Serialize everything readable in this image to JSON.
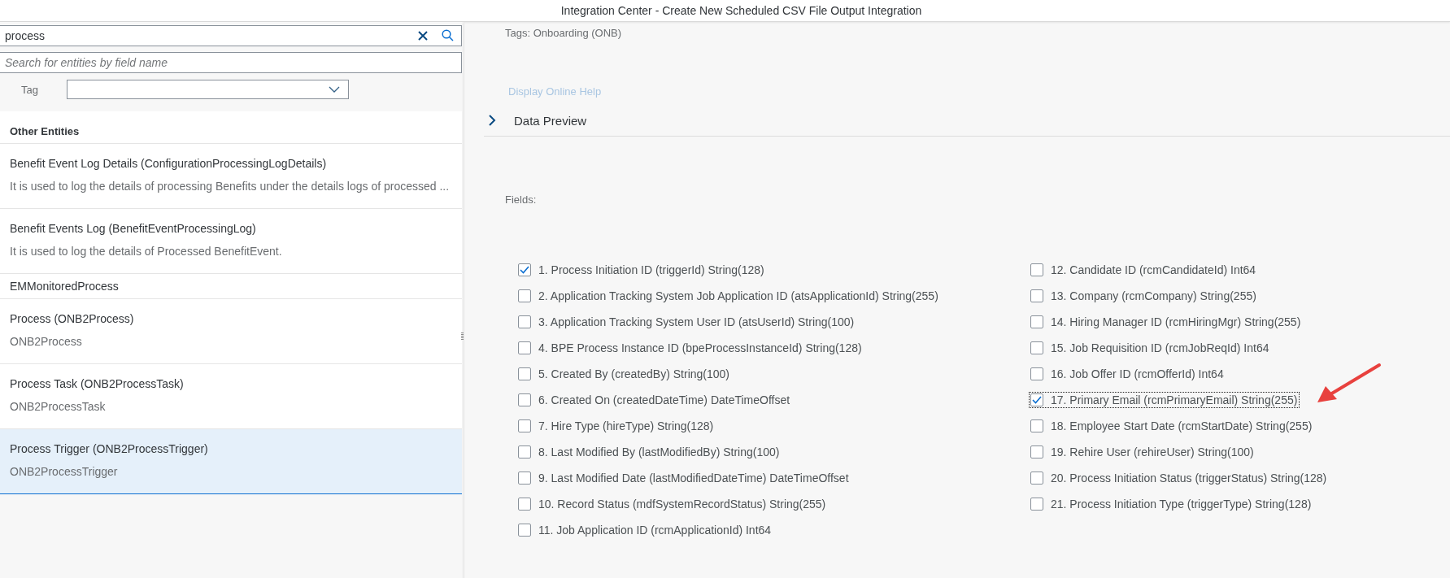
{
  "window": {
    "title": "Integration Center - Create New Scheduled CSV File Output Integration"
  },
  "sidebar": {
    "search": {
      "value": "process"
    },
    "field_search": {
      "placeholder": "Search for entities by field name"
    },
    "tag_label": "Tag",
    "section_title": "Other Entities",
    "items": [
      {
        "title": "Benefit Event Log Details (ConfigurationProcessingLogDetails)",
        "subtitle": "It is used to log the details of processing Benefits under the details logs of processed ...",
        "selected": false
      },
      {
        "title": "Benefit Events Log (BenefitEventProcessingLog)",
        "subtitle": "It is used to log the details of Processed BenefitEvent.",
        "selected": false
      },
      {
        "title": "EMMonitoredProcess",
        "selected": false
      },
      {
        "title": "Process (ONB2Process)",
        "subtitle": "ONB2Process",
        "selected": false
      },
      {
        "title": "Process Task (ONB2ProcessTask)",
        "subtitle": "ONB2ProcessTask",
        "selected": false
      },
      {
        "title": "Process Trigger (ONB2ProcessTrigger)",
        "subtitle": "ONB2ProcessTrigger",
        "selected": true
      }
    ]
  },
  "detail": {
    "tags": "Tags: Onboarding (ONB)",
    "help_link": "Display Online Help",
    "data_preview": {
      "label": "Data Preview",
      "expanded": false
    },
    "fields_label": "Fields:",
    "fields": [
      {
        "label": "1. Process Initiation ID (triggerId) String(128)",
        "checked": true,
        "focused": false
      },
      {
        "label": "2. Application Tracking System Job Application ID (atsApplicationId) String(255)",
        "checked": false,
        "focused": false
      },
      {
        "label": "3. Application Tracking System User ID (atsUserId) String(100)",
        "checked": false,
        "focused": false
      },
      {
        "label": "4. BPE Process Instance ID (bpeProcessInstanceId) String(128)",
        "checked": false,
        "focused": false
      },
      {
        "label": "5. Created By (createdBy) String(100)",
        "checked": false,
        "focused": false
      },
      {
        "label": "6. Created On (createdDateTime) DateTimeOffset",
        "checked": false,
        "focused": false
      },
      {
        "label": "7. Hire Type (hireType) String(128)",
        "checked": false,
        "focused": false
      },
      {
        "label": "8. Last Modified By (lastModifiedBy) String(100)",
        "checked": false,
        "focused": false
      },
      {
        "label": "9. Last Modified Date (lastModifiedDateTime) DateTimeOffset",
        "checked": false,
        "focused": false
      },
      {
        "label": "10. Record Status (mdfSystemRecordStatus) String(255)",
        "checked": false,
        "focused": false
      },
      {
        "label": "11. Job Application ID (rcmApplicationId) Int64",
        "checked": false,
        "focused": false
      },
      {
        "label": "12. Candidate ID (rcmCandidateId) Int64",
        "checked": false,
        "focused": false
      },
      {
        "label": "13. Company (rcmCompany) String(255)",
        "checked": false,
        "focused": false
      },
      {
        "label": "14. Hiring Manager ID (rcmHiringMgr) String(255)",
        "checked": false,
        "focused": false
      },
      {
        "label": "15. Job Requisition ID (rcmJobReqId) Int64",
        "checked": false,
        "focused": false
      },
      {
        "label": "16. Job Offer ID (rcmOfferId) Int64",
        "checked": false,
        "focused": false
      },
      {
        "label": "17. Primary Email (rcmPrimaryEmail) String(255)",
        "checked": true,
        "focused": true
      },
      {
        "label": "18. Employee Start Date (rcmStartDate) String(255)",
        "checked": false,
        "focused": false
      },
      {
        "label": "19. Rehire User (rehireUser) String(100)",
        "checked": false,
        "focused": false
      },
      {
        "label": "20. Process Initiation Status (triggerStatus) String(128)",
        "checked": false,
        "focused": false
      },
      {
        "label": "21. Process Initiation Type (triggerType) String(128)",
        "checked": false,
        "focused": false
      }
    ]
  }
}
